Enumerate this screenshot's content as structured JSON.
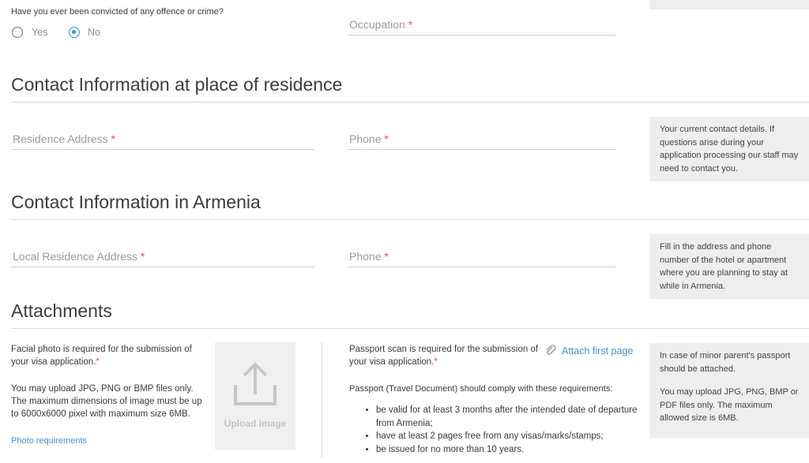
{
  "conviction": {
    "question": "Have you ever been convicted of any offence or crime?",
    "options": [
      "Yes",
      "No"
    ],
    "selected": "No"
  },
  "occupation": {
    "placeholder": "Occupation",
    "required": "*"
  },
  "contact_residence": {
    "heading": "Contact Information at place of residence",
    "address_placeholder": "Residence Address",
    "phone_placeholder": "Phone",
    "required": "*",
    "note": "Your current contact details. If questions arise during your application processing our staff may need to contact you."
  },
  "contact_armenia": {
    "heading": "Contact Information in Armenia",
    "address_placeholder": "Local Residence Address",
    "phone_placeholder": "Phone",
    "required": "*",
    "note": "Fill in the address and phone number of the hotel or apartment where you are planning to stay at while in Armenia."
  },
  "attachments": {
    "heading": "Attachments",
    "photo": {
      "required_text": "Facial photo is required for the submission of your visa application.",
      "required_mark": "*",
      "formats_text": "You may upload JPG, PNG or BMP files only. The maximum dimensions of image must be up to 6000x6000 pixel with maximum size 6MB.",
      "requirements_link": "Photo requirements",
      "upload_label": "Upload image"
    },
    "passport": {
      "required_text": "Passport scan is required for the submission of your visa application.",
      "required_mark": "*",
      "attach_link": "Attach first page",
      "comply_text": "Passport (Travel Document) should comply with these requirements:",
      "requirements": [
        "be valid for at least 3 months after the intended date of departure from Armenia;",
        "have at least 2 pages free from any visas/marks/stamps;",
        "be issued for no more than 10 years."
      ]
    },
    "note_1": "In case of minor parent's passport should be attached.",
    "note_2": "You may upload JPG, PNG, BMP or PDF files only. The maximum allowed size is 6MB."
  },
  "colors": {
    "accent": "#3b8fd6",
    "required": "#e0524b",
    "note_bg": "#eeeeee"
  }
}
